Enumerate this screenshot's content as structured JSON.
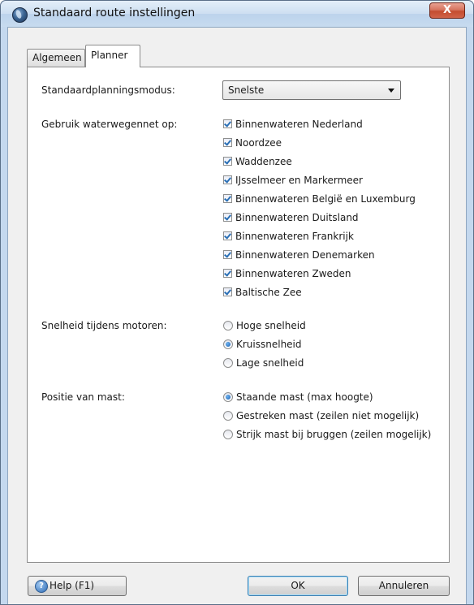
{
  "window": {
    "title": "Standaard route instellingen",
    "close_glyph": "X",
    "app_icon": "globe-icon"
  },
  "tabs": [
    {
      "label": "Algemeen",
      "active": false
    },
    {
      "label": "Planner",
      "active": true
    }
  ],
  "planning": {
    "label": "Standaardplanningsmodus:",
    "selected": "Snelste"
  },
  "waterways": {
    "label": "Gebruik waterwegennet op:",
    "items": [
      {
        "label": "Binnenwateren Nederland",
        "checked": true
      },
      {
        "label": "Noordzee",
        "checked": true
      },
      {
        "label": "Waddenzee",
        "checked": true
      },
      {
        "label": "IJsselmeer en Markermeer",
        "checked": true
      },
      {
        "label": "Binnenwateren België en Luxemburg",
        "checked": true
      },
      {
        "label": "Binnenwateren Duitsland",
        "checked": true
      },
      {
        "label": "Binnenwateren Frankrijk",
        "checked": true
      },
      {
        "label": "Binnenwateren Denemarken",
        "checked": true
      },
      {
        "label": "Binnenwateren Zweden",
        "checked": true
      },
      {
        "label": "Baltische Zee",
        "checked": true
      }
    ]
  },
  "speed": {
    "label": "Snelheid tijdens motoren:",
    "options": [
      {
        "label": "Hoge snelheid",
        "selected": false
      },
      {
        "label": "Kruissnelheid",
        "selected": true
      },
      {
        "label": "Lage snelheid",
        "selected": false
      }
    ]
  },
  "mast": {
    "label": "Positie van mast:",
    "options": [
      {
        "label": "Staande mast (max hoogte)",
        "selected": true
      },
      {
        "label": "Gestreken mast (zeilen niet mogelijk)",
        "selected": false
      },
      {
        "label": "Strijk mast bij bruggen (zeilen mogelijk)",
        "selected": false
      }
    ]
  },
  "buttons": {
    "help": "Help (F1)",
    "ok": "OK",
    "cancel": "Annuleren"
  }
}
